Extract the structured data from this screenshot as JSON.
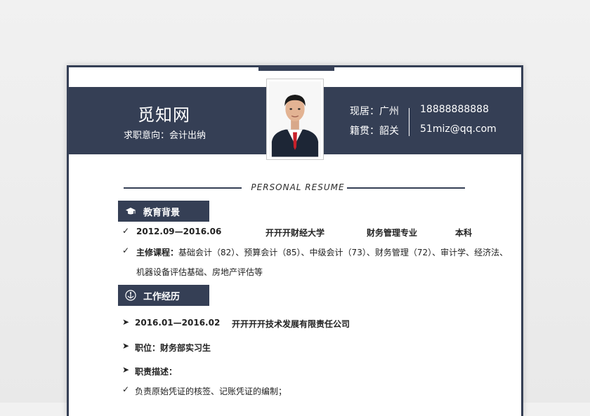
{
  "header": {
    "name": "觅知网",
    "intent": "求职意向：会计出纳",
    "residence": "现居：广州",
    "origin": "籍贯：韶关",
    "phone": "18888888888",
    "email": "51miz@qq.com"
  },
  "resume_title": "PERSONAL RESUME",
  "education": {
    "title": "教育背景",
    "period": "2012.09—2016.06",
    "school": "开开开财经大学",
    "major": "财务管理专业",
    "degree": "本科",
    "courses_label": "主修课程：",
    "courses_line1": "基础会计（82）、预算会计（85）、中级会计（73）、财务管理（72）、审计学、经济法、",
    "courses_line2": "机器设备评估基础、房地产评估等"
  },
  "work": {
    "title": "工作经历",
    "period": "2016.01—2016.02",
    "company": "开开开开技术发展有限责任公司",
    "position": "职位：财务部实习生",
    "duties_label": "职责描述：",
    "duty1": "负责原始凭证的核签、记账凭证的编制；"
  },
  "watermark": "觅知网",
  "colors": {
    "accent": "#353f55",
    "background": "#ececec",
    "paper": "#ffffff"
  },
  "icons": {
    "education": "graduation-cap-icon",
    "work": "anchor-icon",
    "check": "check-icon",
    "arrow": "arrow-right-icon"
  }
}
